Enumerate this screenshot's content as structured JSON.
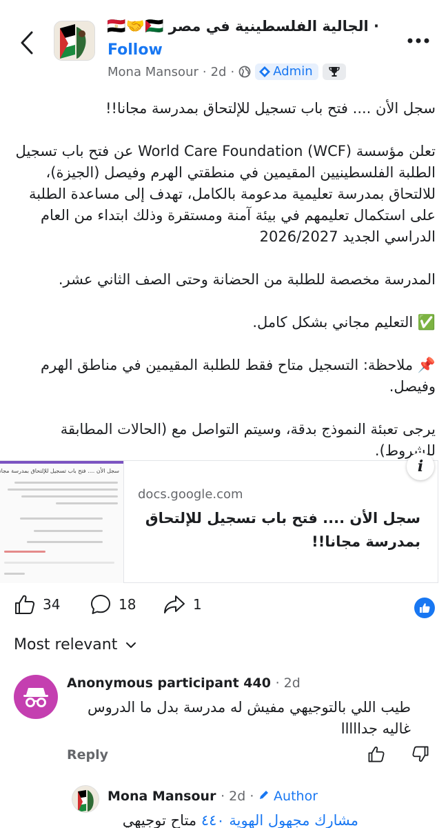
{
  "header": {
    "group_name": "الجالية الفلسطينية في مصر",
    "flags": "🇪🇬🤝🇵🇸",
    "prefix_dot": "·",
    "follow_label": "Follow",
    "author": "Mona Mansour",
    "time": "2d",
    "admin_label": "Admin"
  },
  "post": {
    "paragraphs": [
      "سجل الأن .... فتح باب تسجيل للإلتحاق بمدرسة مجانا!!",
      "تعلن مؤسسة World Care Foundation (WCF) عن فتح باب تسجيل الطلبة الفلسطينيين المقيمين في منطقتي الهرم وفيصل (الجيزة)، للالتحاق بمدرسة تعليمية مدعومة بالكامل، تهدف إلى مساعدة الطلبة على استكمال تعليمهم في بيئة آمنة ومستقرة وذلك ابتداء من العام الدراسي الجديد 2026/2027",
      "المدرسة مخصصة للطلبة من الحضانة وحتى الصف الثاني  عشر.",
      "✅ التعليم مجاني بشكل كامل.",
      "📌 ملاحظة: التسجيل متاح فقط للطلبة المقيمين في مناطق الهرم وفيصل.",
      "يرجى تعبئة النموذج بدقة، وسيتم التواصل مع (الحالات المطابقة للشروط)."
    ]
  },
  "link": {
    "domain": "docs.google.com",
    "title": "سجل الأن .... فتح باب تسجيل للإلتحاق بمدرسة مجانا!!",
    "thumb_text": "سجل الأن .... فتح باب تسجيل للإلتحاق بمدرسة مجانا"
  },
  "actions": {
    "likes": "34",
    "comments": "18",
    "shares": "1"
  },
  "sort": {
    "label": "Most relevant"
  },
  "comment": {
    "author": "Anonymous participant 440",
    "time": "· 2d",
    "text": "طيب اللي بالتوجيهي مفيش له مدرسة بدل ما الدروس غاليه جدااااا",
    "reply_label": "Reply"
  },
  "reply": {
    "author": "Mona Mansour",
    "time": "· 2d ·",
    "author_badge": "Author",
    "mention": "مشارك مجهول الهوية ٤٤٠",
    "text": " متاح توجيهي"
  },
  "colors": {
    "accent": "#1877f2",
    "anon_avatar": "#c43fb0",
    "muted": "#65676b"
  }
}
